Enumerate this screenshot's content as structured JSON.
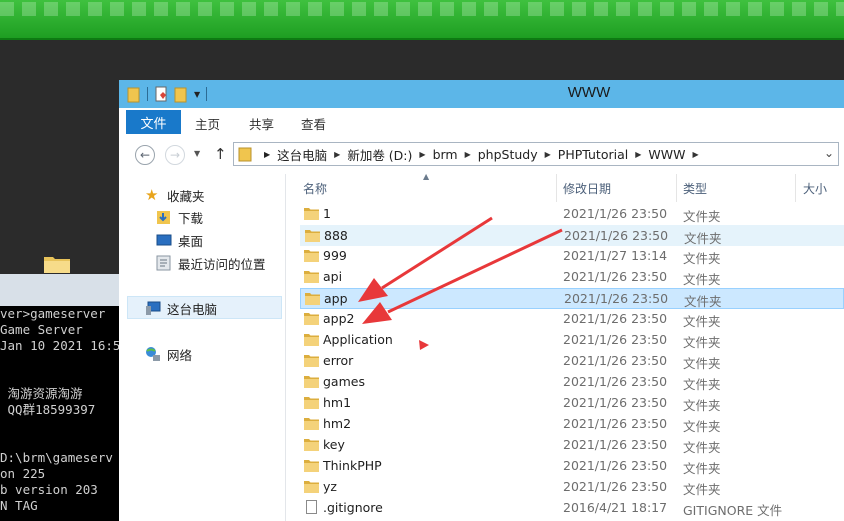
{
  "window": {
    "title": "WWW"
  },
  "ribbon": {
    "tabs": [
      "文件",
      "主页",
      "共享",
      "查看"
    ]
  },
  "address": {
    "path": [
      "这台电脑",
      "新加卷 (D:)",
      "brm",
      "phpStudy",
      "PHPTutorial",
      "WWW"
    ]
  },
  "navpane": {
    "favorites": "收藏夹",
    "downloads": "下载",
    "desktop": "桌面",
    "recent": "最近访问的位置",
    "this_pc": "这台电脑",
    "network": "网络"
  },
  "columns": {
    "name": "名称",
    "date": "修改日期",
    "type": "类型",
    "size": "大小"
  },
  "files": [
    {
      "name": "1",
      "date": "2021/1/26 23:50",
      "type": "文件夹"
    },
    {
      "name": "888",
      "date": "2021/1/26 23:50",
      "type": "文件夹"
    },
    {
      "name": "999",
      "date": "2021/1/27 13:14",
      "type": "文件夹"
    },
    {
      "name": "api",
      "date": "2021/1/26 23:50",
      "type": "文件夹"
    },
    {
      "name": "app",
      "date": "2021/1/26 23:50",
      "type": "文件夹"
    },
    {
      "name": "app2",
      "date": "2021/1/26 23:50",
      "type": "文件夹"
    },
    {
      "name": "Application",
      "date": "2021/1/26 23:50",
      "type": "文件夹"
    },
    {
      "name": "error",
      "date": "2021/1/26 23:50",
      "type": "文件夹"
    },
    {
      "name": "games",
      "date": "2021/1/26 23:50",
      "type": "文件夹"
    },
    {
      "name": "hm1",
      "date": "2021/1/26 23:50",
      "type": "文件夹"
    },
    {
      "name": "hm2",
      "date": "2021/1/26 23:50",
      "type": "文件夹"
    },
    {
      "name": "key",
      "date": "2021/1/26 23:50",
      "type": "文件夹"
    },
    {
      "name": "ThinkPHP",
      "date": "2021/1/26 23:50",
      "type": "文件夹"
    },
    {
      "name": "yz",
      "date": "2021/1/26 23:50",
      "type": "文件夹"
    },
    {
      "name": ".gitignore",
      "date": "2016/4/21 18:17",
      "type": "GITIGNORE 文件"
    }
  ],
  "console": {
    "lines": [
      "ver>gameserver",
      "Game Server",
      "Jan 10 2021 16:5",
      "",
      "",
      " 淘游资源淘游",
      " QQ群18599397",
      "",
      "",
      "D:\\brm\\gameserv",
      "on 225",
      "b version 203",
      "N TAG"
    ]
  },
  "colors": {
    "accent": "#1979ca",
    "titlebar": "#5cb6e8",
    "selection": "#cce8ff",
    "arrow": "#e8383a",
    "desktop_bar": "#2fb52f"
  }
}
